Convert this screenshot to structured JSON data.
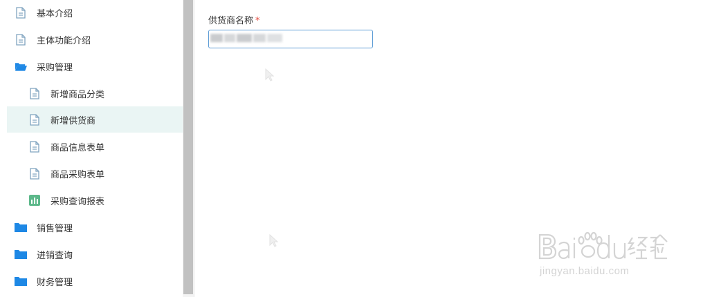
{
  "sidebar": {
    "items": [
      {
        "label": "基本介绍",
        "icon": "document-icon",
        "level": 1,
        "active": false
      },
      {
        "label": "主体功能介绍",
        "icon": "document-icon",
        "level": 1,
        "active": false
      },
      {
        "label": "采购管理",
        "icon": "folder-open-icon",
        "level": 1,
        "active": false
      },
      {
        "label": "新增商品分类",
        "icon": "document-icon",
        "level": 2,
        "active": false
      },
      {
        "label": "新增供货商",
        "icon": "document-icon",
        "level": 2,
        "active": true
      },
      {
        "label": "商品信息表单",
        "icon": "document-icon",
        "level": 2,
        "active": false
      },
      {
        "label": "商品采购表单",
        "icon": "document-icon",
        "level": 2,
        "active": false
      },
      {
        "label": "采购查询报表",
        "icon": "bar-chart-icon",
        "level": 2,
        "active": false
      },
      {
        "label": "销售管理",
        "icon": "folder-icon",
        "level": 1,
        "active": false
      },
      {
        "label": "进销查询",
        "icon": "folder-icon",
        "level": 1,
        "active": false
      },
      {
        "label": "财务管理",
        "icon": "folder-icon",
        "level": 1,
        "active": false
      }
    ]
  },
  "form": {
    "supplier_name": {
      "label": "供货商名称",
      "required_mark": "*"
    }
  },
  "watermark": {
    "text": "jingyan.baidu.com"
  },
  "colors": {
    "active_bg": "#eaf5f4",
    "folder_blue": "#1e88e5",
    "doc_icon": "#7fa3bf",
    "chart_green": "#5cb88a",
    "input_border": "#5b9bd5",
    "required_red": "#e54d42"
  }
}
